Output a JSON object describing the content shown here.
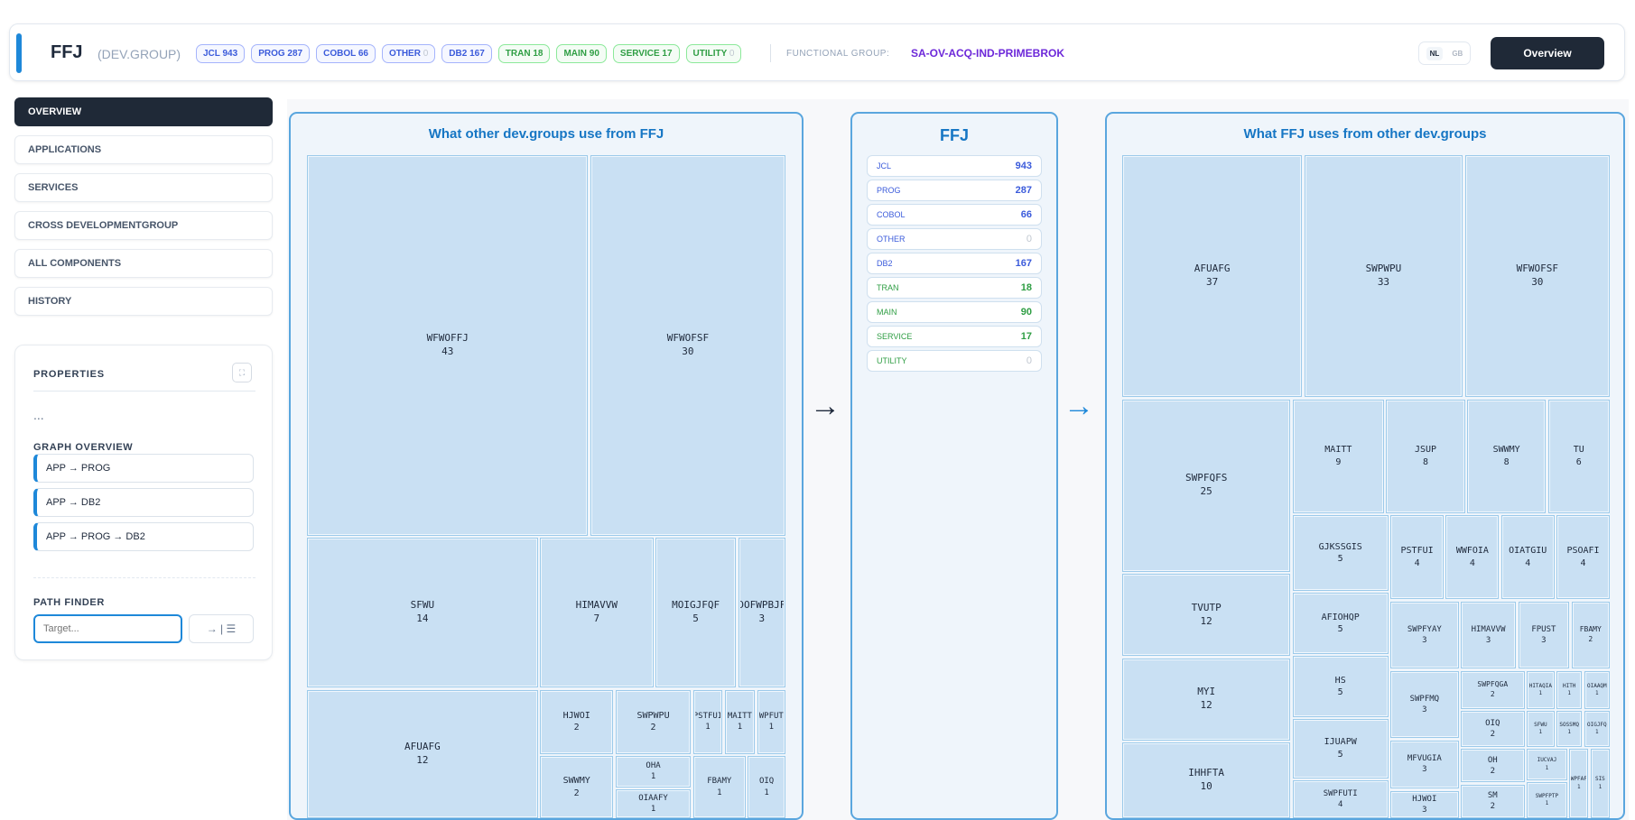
{
  "header": {
    "title": "FFJ",
    "subtitle": "(DEV.GROUP)",
    "badges": [
      {
        "label": "JCL 943",
        "zero": "",
        "color": "blue"
      },
      {
        "label": "PROG 287",
        "zero": "",
        "color": "blue"
      },
      {
        "label": "COBOL 66",
        "zero": "",
        "color": "blue"
      },
      {
        "label": "OTHER",
        "zero": "0",
        "color": "blue"
      },
      {
        "label": "DB2 167",
        "zero": "",
        "color": "blue"
      },
      {
        "label": "TRAN 18",
        "zero": "",
        "color": "green"
      },
      {
        "label": "MAIN 90",
        "zero": "",
        "color": "green"
      },
      {
        "label": "SERVICE 17",
        "zero": "",
        "color": "green"
      },
      {
        "label": "UTILITY",
        "zero": "0",
        "color": "green"
      }
    ],
    "functional_group_label": "FUNCTIONAL GROUP:",
    "functional_group_value": "SA-OV-ACQ-IND-PRIMEBROK",
    "lang_on": "NL",
    "lang_off": "GB",
    "overview_button": "Overview"
  },
  "sidebar": {
    "items": [
      {
        "label": "OVERVIEW",
        "active": true
      },
      {
        "label": "APPLICATIONS",
        "active": false
      },
      {
        "label": "SERVICES",
        "active": false
      },
      {
        "label": "CROSS DEVELOPMENTGROUP",
        "active": false
      },
      {
        "label": "ALL COMPONENTS",
        "active": false
      },
      {
        "label": "HISTORY",
        "active": false
      }
    ]
  },
  "properties": {
    "title": "PROPERTIES",
    "ellipsis": "...",
    "graph_overview_title": "GRAPH OVERVIEW",
    "paths": [
      "APP → PROG",
      "APP → DB2",
      "APP → PROG → DB2"
    ],
    "path_finder_title": "PATH FINDER",
    "target_placeholder": "Target...",
    "finder_button": "→ | ☰"
  },
  "left_panel": {
    "title": "What other dev.groups use from FFJ",
    "cells": [
      {
        "name": "WFWOFFJ",
        "value": "43"
      },
      {
        "name": "WFWOFSF",
        "value": "30"
      },
      {
        "name": "SFWU",
        "value": "14"
      },
      {
        "name": "HIMAVVW",
        "value": "7"
      },
      {
        "name": "MOIGJFQF",
        "value": "5"
      },
      {
        "name": "DOFWPBJF",
        "value": "3"
      },
      {
        "name": "AFUAFG",
        "value": "12"
      },
      {
        "name": "HJWOI",
        "value": "2"
      },
      {
        "name": "SWPWPU",
        "value": "2"
      },
      {
        "name": "PSTFUI",
        "value": "1"
      },
      {
        "name": "MAITT",
        "value": "1"
      },
      {
        "name": "WPFUT",
        "value": "1"
      },
      {
        "name": "SWWMY",
        "value": "2"
      },
      {
        "name": "OHA",
        "value": "1"
      },
      {
        "name": "OIAAFY",
        "value": "1"
      },
      {
        "name": "FBAMY",
        "value": "1"
      },
      {
        "name": "OIQ",
        "value": "1"
      }
    ]
  },
  "center_panel": {
    "title": "FFJ",
    "stats": [
      {
        "label": "JCL",
        "value": "943",
        "color": "blue"
      },
      {
        "label": "PROG",
        "value": "287",
        "color": "blue"
      },
      {
        "label": "COBOL",
        "value": "66",
        "color": "blue"
      },
      {
        "label": "OTHER",
        "value": "0",
        "color": "muted"
      },
      {
        "label": "DB2",
        "value": "167",
        "color": "blue"
      },
      {
        "label": "TRAN",
        "value": "18",
        "color": "green"
      },
      {
        "label": "MAIN",
        "value": "90",
        "color": "green"
      },
      {
        "label": "SERVICE",
        "value": "17",
        "color": "green"
      },
      {
        "label": "UTILITY",
        "value": "0",
        "color": "mutedg"
      }
    ]
  },
  "arrows": {
    "left": "→",
    "right": "→"
  },
  "right_panel": {
    "title": "What FFJ uses from other dev.groups",
    "cells": [
      {
        "name": "AFUAFG",
        "value": "37"
      },
      {
        "name": "SWPWPU",
        "value": "33"
      },
      {
        "name": "WFWOFSF",
        "value": "30"
      },
      {
        "name": "SWPFQFS",
        "value": "25"
      },
      {
        "name": "MAITT",
        "value": "9"
      },
      {
        "name": "JSUP",
        "value": "8"
      },
      {
        "name": "SWWMY",
        "value": "8"
      },
      {
        "name": "TU",
        "value": "6"
      },
      {
        "name": "GJKSSGIS",
        "value": "5"
      },
      {
        "name": "PSTFUI",
        "value": "4"
      },
      {
        "name": "WWFOIA",
        "value": "4"
      },
      {
        "name": "OIATGIU",
        "value": "4"
      },
      {
        "name": "PSOAFI",
        "value": "4"
      },
      {
        "name": "TVUTP",
        "value": "12"
      },
      {
        "name": "AFIOHQP",
        "value": "5"
      },
      {
        "name": "SWPFYAY",
        "value": "3"
      },
      {
        "name": "HIMAVVW",
        "value": "3"
      },
      {
        "name": "FPUST",
        "value": "3"
      },
      {
        "name": "FBAMY",
        "value": "2"
      },
      {
        "name": "MYI",
        "value": "12"
      },
      {
        "name": "HS",
        "value": "5"
      },
      {
        "name": "SWPFMQ",
        "value": "3"
      },
      {
        "name": "SWPFQGA",
        "value": "2"
      },
      {
        "name": "HITAQIA",
        "value": "1"
      },
      {
        "name": "HITH",
        "value": "1"
      },
      {
        "name": "OIAAQM",
        "value": "1"
      },
      {
        "name": "IJUAPW",
        "value": "5"
      },
      {
        "name": "MFVUGIA",
        "value": "3"
      },
      {
        "name": "OIQ",
        "value": "2"
      },
      {
        "name": "SFWU",
        "value": "1"
      },
      {
        "name": "SOSSMQ",
        "value": "1"
      },
      {
        "name": "OIGJFQ",
        "value": "1"
      },
      {
        "name": "IHHFTA",
        "value": "10"
      },
      {
        "name": "SWPFUTI",
        "value": "4"
      },
      {
        "name": "HJWOI",
        "value": "3"
      },
      {
        "name": "OH",
        "value": "2"
      },
      {
        "name": "SM",
        "value": "2"
      },
      {
        "name": "IUCVAJ",
        "value": "1"
      },
      {
        "name": "SWPFPTP",
        "value": "1"
      },
      {
        "name": "WPFAF",
        "value": "1"
      },
      {
        "name": "SIS",
        "value": "1"
      }
    ]
  }
}
